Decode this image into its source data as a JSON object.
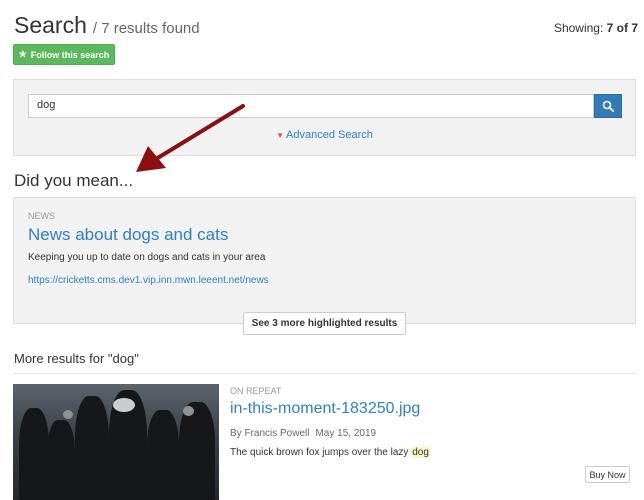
{
  "header": {
    "title": "Search",
    "subtitle": "/ 7 results found",
    "showing_label": "Showing:",
    "showing_value": "7 of 7"
  },
  "follow_button": {
    "label": "Follow this search",
    "icon": "star-icon"
  },
  "search": {
    "value": "dog",
    "button_icon": "search-icon",
    "advanced_label": "Advanced Search"
  },
  "did_you_mean": {
    "heading": "Did you mean...",
    "category": "NEWS",
    "title": "News about dogs and cats",
    "description": "Keeping you up to date on dogs and cats in your area",
    "url": "https://cricketts.cms.dev1.vip.inn.mwn.leeent.net/news",
    "see_more_label": "See 3 more highlighted results"
  },
  "more_results": {
    "heading": "More results for \"dog\"",
    "items": [
      {
        "category": "ON REPEAT",
        "title": "in-this-moment-183250.jpg",
        "author": "By Francis Powell",
        "date": "May 15, 2019",
        "snippet_before": "The quick brown fox jumps over the lazy ",
        "snippet_highlight": "dog",
        "buy_label": "Buy Now"
      }
    ]
  },
  "colors": {
    "accent_blue": "#337ab7",
    "link_blue": "#2f80c5",
    "follow_green": "#5cb85c",
    "annotation_arrow": "#8b0f12",
    "highlight": "#fcf8c8"
  }
}
